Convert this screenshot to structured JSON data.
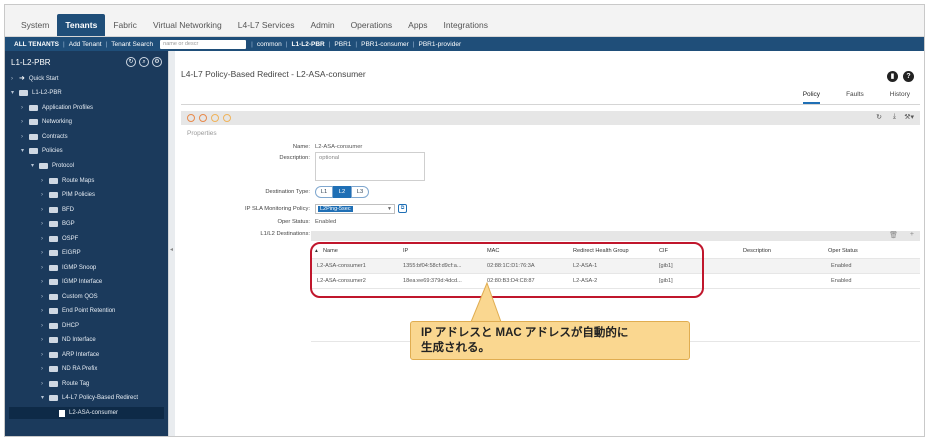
{
  "top_tabs": [
    "System",
    "Tenants",
    "Fabric",
    "Virtual Networking",
    "L4-L7 Services",
    "Admin",
    "Operations",
    "Apps",
    "Integrations"
  ],
  "active_top_tab": "Tenants",
  "subnav": {
    "all_tenants": "ALL TENANTS",
    "add_tenant": "Add Tenant",
    "tenant_search_label": "Tenant Search",
    "tenant_search_placeholder": "name or descr",
    "items": [
      "common",
      "L1-L2-PBR",
      "PBR1",
      "PBR1-consumer",
      "PBR1-provider"
    ]
  },
  "sidebar": {
    "title": "L1-L2-PBR",
    "items": [
      {
        "label": "Quick Start"
      },
      {
        "label": "L1-L2-PBR"
      },
      {
        "label": "Application Profiles"
      },
      {
        "label": "Networking"
      },
      {
        "label": "Contracts"
      },
      {
        "label": "Policies"
      },
      {
        "label": "Protocol"
      },
      {
        "label": "Route Maps"
      },
      {
        "label": "PIM Policies"
      },
      {
        "label": "BFD"
      },
      {
        "label": "BGP"
      },
      {
        "label": "OSPF"
      },
      {
        "label": "EIGRP"
      },
      {
        "label": "IGMP Snoop"
      },
      {
        "label": "IGMP Interface"
      },
      {
        "label": "Custom QOS"
      },
      {
        "label": "End Point Retention"
      },
      {
        "label": "DHCP"
      },
      {
        "label": "ND Interface"
      },
      {
        "label": "ARP Interface"
      },
      {
        "label": "ND RA Prefix"
      },
      {
        "label": "Route Tag"
      },
      {
        "label": "L4-L7 Policy-Based Redirect"
      },
      {
        "label": "L2-ASA-consumer"
      }
    ]
  },
  "main": {
    "title": "L4-L7 Policy-Based Redirect - L2-ASA-consumer",
    "view_tabs": [
      "Policy",
      "Faults",
      "History"
    ],
    "active_view_tab": "Policy",
    "section_label": "Properties",
    "form": {
      "name_label": "Name:",
      "name_value": "L2-ASA-consumer",
      "description_label": "Description:",
      "description_placeholder": "optional",
      "destination_type_label": "Destination Type:",
      "destination_type_options": [
        "L1",
        "L2",
        "L3"
      ],
      "destination_type_selected": "L2",
      "ip_sla_label": "IP SLA Monitoring Policy:",
      "ip_sla_value": "L2Ping-5sec",
      "oper_status_label": "Oper Status:",
      "oper_status_value": "Enabled",
      "destinations_label": "L1/L2 Destinations:"
    },
    "table": {
      "columns": [
        "Name",
        "IP",
        "MAC",
        "Redirect Health Group",
        "CIF",
        "Description",
        "Oper Status"
      ],
      "rows": [
        [
          "L2-ASA-consumer1",
          "1355:bf04:58cf:d9cf:a...",
          "02:88:1C:D1:76:3A",
          "L2-ASA-1",
          "[gib1]",
          "",
          "Enabled"
        ],
        [
          "L2-ASA-consumer2",
          "18ea:ee69:379d:4dcd...",
          "02:80:B3:D4:C8:87",
          "L2-ASA-2",
          "[gib1]",
          "",
          "Enabled"
        ]
      ]
    }
  },
  "callout": {
    "line1": "IP アドレスと MAC アドレスが自動的に",
    "line2": "生成される。"
  },
  "colors": {
    "nav_blue": "#1f4e79",
    "sidebar_bg": "#1b3a5c",
    "highlight_red": "#c0162c",
    "callout_fill": "#fad790"
  }
}
